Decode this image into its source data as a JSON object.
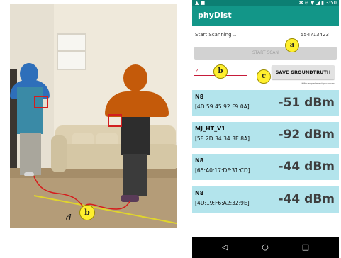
{
  "photo": {
    "markers": {
      "b": "b"
    },
    "distance_label": "d"
  },
  "phone": {
    "status": {
      "left_icons": "▲ ■",
      "right_icons": "✱ ⊖ ▼ ◢ ▮",
      "time": "3:50"
    },
    "app_title": "phyDist",
    "scan": {
      "label": "Start Scanning ..",
      "timestamp": "554713423"
    },
    "start_button": "START SCAN",
    "groundtruth_value": "2",
    "save_button": "SAVE GROUNDTRUTH",
    "note": "**for experiment purposes",
    "markers": {
      "a": "a",
      "b": "b",
      "c": "c"
    },
    "devices": [
      {
        "name": "N8",
        "mac": "[4D:59:45:92:F9:0A]",
        "rssi": "-51 dBm"
      },
      {
        "name": "MJ_HT_V1",
        "mac": "[58:2D:34:34:3E:8A]",
        "rssi": "-92 dBm"
      },
      {
        "name": "N8",
        "mac": "[65:A0:17:DF:31:CD]",
        "rssi": "-44 dBm"
      },
      {
        "name": "N8",
        "mac": "[4D:19:F6:A2:32:9E]",
        "rssi": "-44 dBm"
      }
    ],
    "nav": {
      "back": "◁",
      "home": "○",
      "recent": "□"
    },
    "colors": {
      "appbar": "#129688",
      "statusbar": "#0c7f73",
      "device_row": "#b3e4ec",
      "marker": "#ffef2e",
      "input_line": "#c61c3a"
    }
  }
}
